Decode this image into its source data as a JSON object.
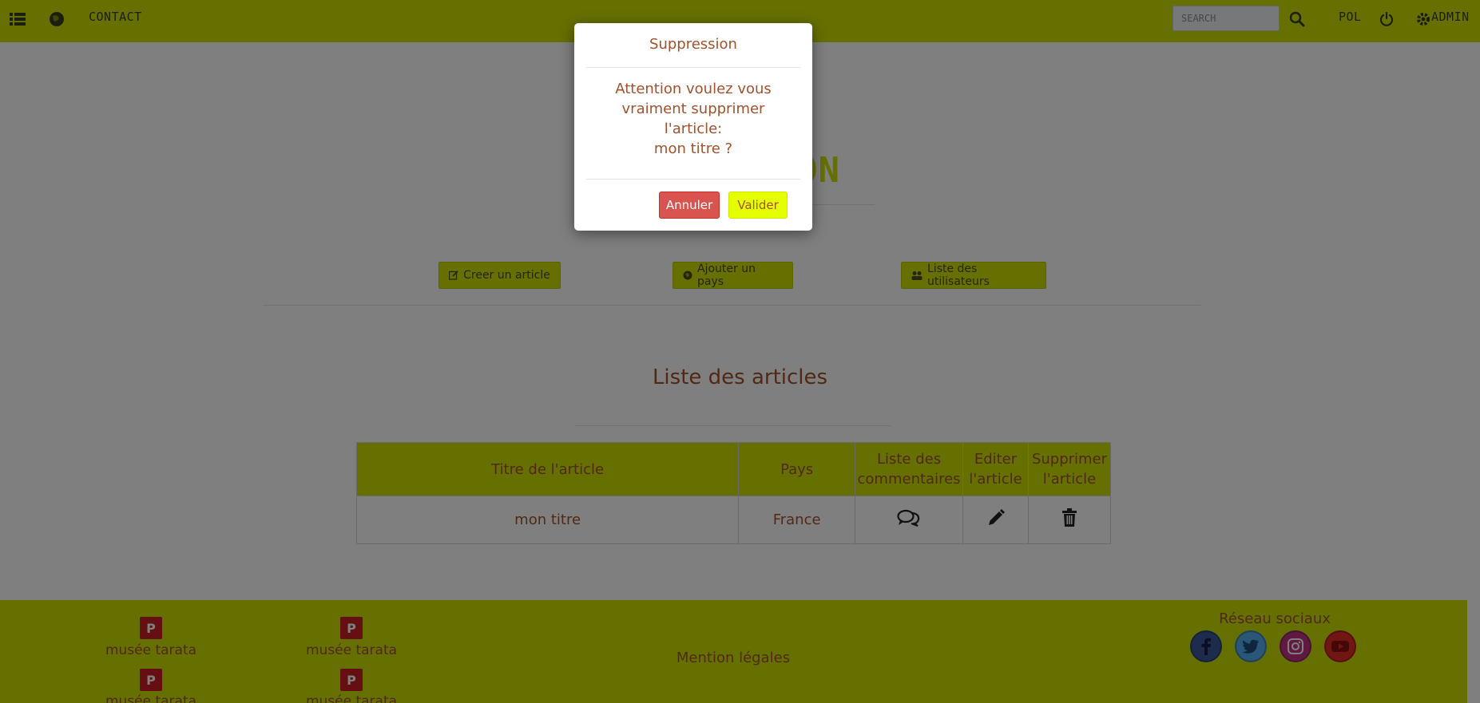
{
  "nav": {
    "contact_label": "CONTACT",
    "search_placeholder": "SEARCH",
    "lang_label": "POL",
    "admin_label": "ADMIN",
    "menu_icon": "list-icon",
    "brand_icon": "globe-icon",
    "search_icon": "search-icon",
    "power_icon": "power-icon",
    "gear_icon": "gears-icon"
  },
  "main": {
    "title_suffix": "ON",
    "actions": [
      {
        "label": "Creer un article",
        "icon": "edit-icon"
      },
      {
        "label": "Ajouter un pays",
        "icon": "globe-icon"
      },
      {
        "label": "Liste des utilisateurs",
        "icon": "users-icon"
      }
    ],
    "section_title": "Liste des articles"
  },
  "table": {
    "headers": [
      "Titre de l'article",
      "Pays",
      "Liste des commentaires",
      "Editer l'article",
      "Supprimer l'article"
    ],
    "rows": [
      {
        "title": "mon titre",
        "country": "France",
        "comments_icon": "comments-icon",
        "edit_icon": "pencil-icon",
        "delete_icon": "trash-icon"
      }
    ]
  },
  "footer": {
    "links": [
      "musée tarata",
      "musée tarata",
      "musée tarata",
      "musée tarata"
    ],
    "legal": "Mention légales",
    "social_title": "Réseau sociaux",
    "social_icons": [
      "facebook-icon",
      "twitter-icon",
      "instagram-icon",
      "youtube-icon"
    ]
  },
  "modal": {
    "title": "Suppression",
    "body_lines": [
      "Attention voulez vous",
      "vraiment supprimer",
      "l'article:",
      "mon titre ?"
    ],
    "cancel_label": "Annuler",
    "confirm_label": "Valider"
  },
  "colors": {
    "primary": "#cde000",
    "text": "#a0522d",
    "danger": "#d9534f",
    "confirm": "#e5ff00",
    "overlay": "rgba(0,0,0,0.5)"
  }
}
